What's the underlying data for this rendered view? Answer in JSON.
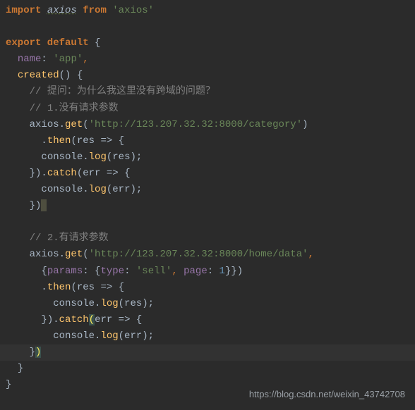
{
  "code": {
    "l1_import": "import",
    "l1_axios": "axios",
    "l1_from": "from",
    "l1_pkg": "'axios'",
    "l3_export": "export default",
    "l3_brace": " {",
    "l4_name_key": "name",
    "l4_name_val": "'app'",
    "l5_created": "created",
    "l5_paren": "() {",
    "l6_comment": "// 提问：为什么我这里没有跨域的问题？",
    "l7_comment": "// 1.没有请求参数",
    "l8_axios": "axios",
    "l8_get": "get",
    "l8_url": "'http://123.207.32.32:8000/category'",
    "l9_then": "then",
    "l9_res": "res",
    "l9_arrow": " => {",
    "l10_console": "console",
    "l10_log": "log",
    "l10_respar": "(res);",
    "l11_close": "}).",
    "l11_catch": "catch",
    "l11_err": "err",
    "l11_arrow": " => {",
    "l12_console": "console",
    "l12_log": "log",
    "l12_errpar": "(err);",
    "l13_close": "})",
    "l15_comment": "// 2.有请求参数",
    "l16_axios": "axios",
    "l16_get": "get",
    "l16_url": "'http://123.207.32.32:8000/home/data'",
    "l17_params": "params",
    "l17_type": "type",
    "l17_typeval": "'sell'",
    "l17_page": "page",
    "l17_pageval": "1",
    "l18_then": "then",
    "l18_res": "res",
    "l18_arrow": " => {",
    "l19_console": "console",
    "l19_log": "log",
    "l19_respar": "(res);",
    "l20_close": "}).",
    "l20_catch": "catch",
    "l20_err": "err",
    "l20_arrow": " => {",
    "l21_console": "console",
    "l21_log": "log",
    "l21_errpar": "(err);",
    "l22_close": "}",
    "l23_close": "}",
    "l24_close": "}"
  },
  "watermark": "https://blog.csdn.net/weixin_43742708"
}
